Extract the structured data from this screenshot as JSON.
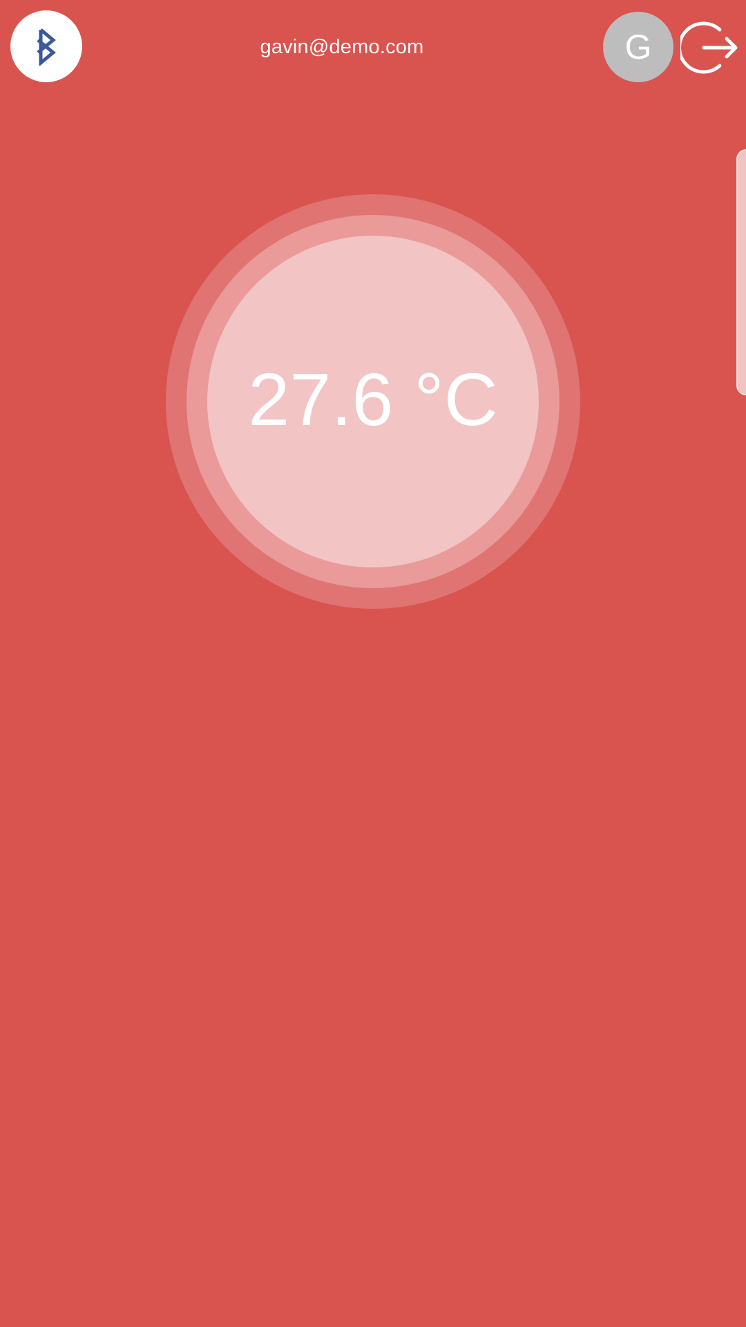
{
  "header": {
    "bluetooth_icon": "bluetooth-icon",
    "user_email": "gavin@demo.com",
    "avatar_initial": "G",
    "logout_icon": "logout-icon"
  },
  "thermometer": {
    "reading": "27.6 °C"
  },
  "colors": {
    "background": "#d9534f",
    "ring_outer": "#e07472",
    "ring_middle": "#e99a99",
    "ring_inner": "#f2c4c4",
    "bluetooth_icon": "#3b5998",
    "avatar": "#bdbdbd",
    "text": "#ffffff"
  }
}
